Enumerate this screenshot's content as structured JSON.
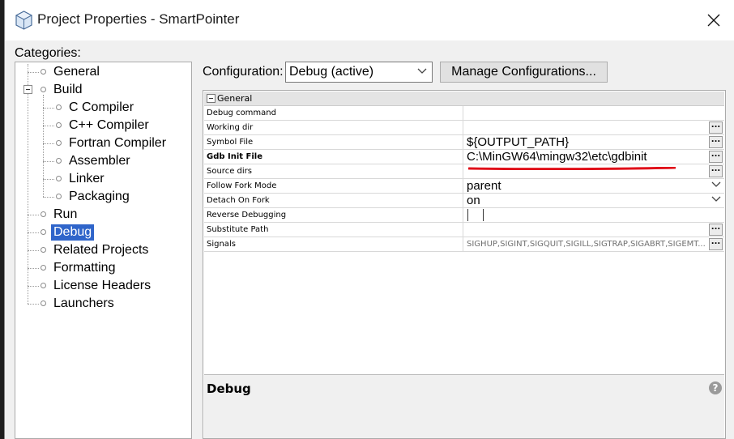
{
  "window": {
    "title": "Project Properties - SmartPointer",
    "close_glyph": "✕"
  },
  "categories": {
    "label": "Categories:",
    "items": [
      {
        "label": "General"
      },
      {
        "label": "Build"
      },
      {
        "label": "C Compiler"
      },
      {
        "label": "C++ Compiler"
      },
      {
        "label": "Fortran Compiler"
      },
      {
        "label": "Assembler"
      },
      {
        "label": "Linker"
      },
      {
        "label": "Packaging"
      },
      {
        "label": "Run"
      },
      {
        "label": "Debug"
      },
      {
        "label": "Related Projects"
      },
      {
        "label": "Formatting"
      },
      {
        "label": "License Headers"
      },
      {
        "label": "Launchers"
      }
    ],
    "selected": "Debug"
  },
  "configuration": {
    "label": "Configuration:",
    "value": "Debug (active)",
    "manage_button": "Manage Configurations..."
  },
  "properties": {
    "section": "General",
    "ellipsis": "...",
    "rows": [
      {
        "name": "Debug command",
        "value": ""
      },
      {
        "name": "Working dir",
        "value": ""
      },
      {
        "name": "Symbol File",
        "value": "${OUTPUT_PATH}"
      },
      {
        "name": "Gdb Init File",
        "value": "C:\\MinGW64\\mingw32\\etc\\gdbinit"
      },
      {
        "name": "Source dirs",
        "value": ""
      },
      {
        "name": "Follow Fork Mode",
        "value": "parent"
      },
      {
        "name": "Detach On Fork",
        "value": "on"
      },
      {
        "name": "Reverse Debugging",
        "value": ""
      },
      {
        "name": "Substitute Path",
        "value": ""
      },
      {
        "name": "Signals",
        "value": "SIGHUP,SIGINT,SIGQUIT,SIGILL,SIGTRAP,SIGABRT,SIGEMT..."
      }
    ]
  },
  "help": {
    "title": "Debug",
    "icon": "?"
  },
  "colors": {
    "selection": "#2f65ca",
    "annotation_underline": "#e0101a"
  }
}
